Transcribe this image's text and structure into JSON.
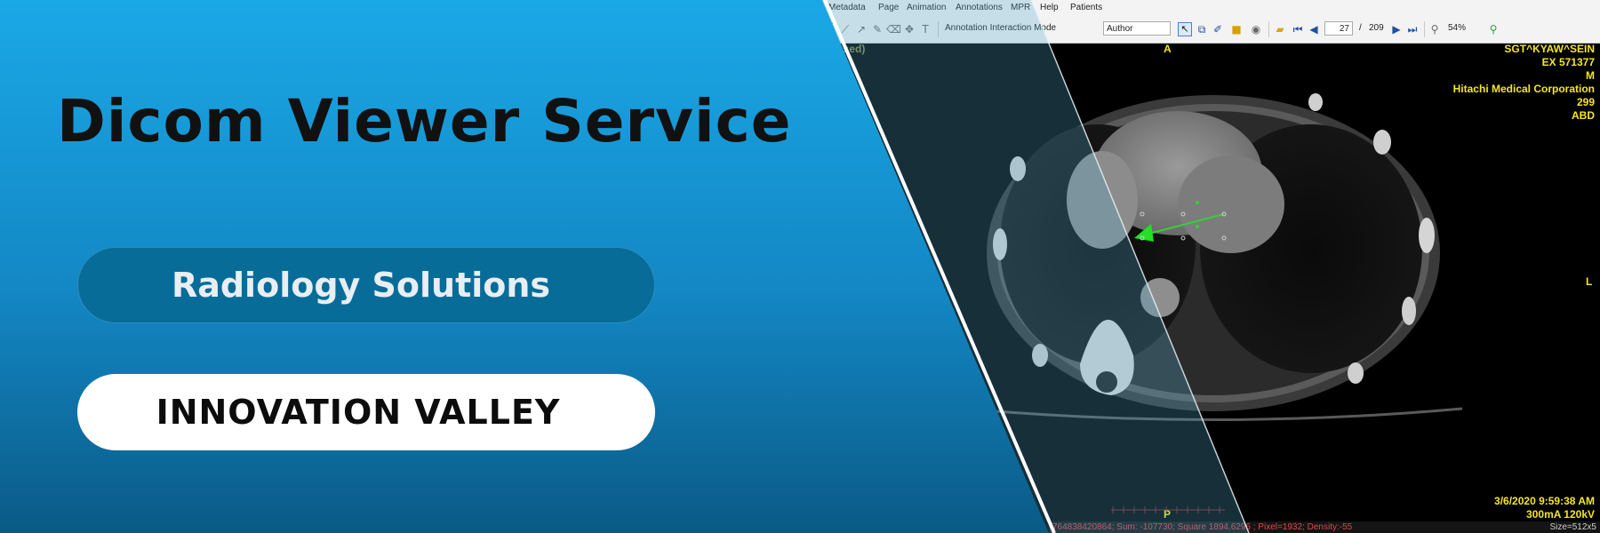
{
  "banner": {
    "headline": "Dicom Viewer Service",
    "tagline": "Radiology Solutions",
    "brand": "INNOVATION VALLEY",
    "colors": {
      "gradient_top": "#1aa8e6",
      "gradient_bottom": "#0a5a86",
      "pill_dark": "#086c99",
      "pill_light": "#ffffff",
      "headline": "#111111"
    }
  },
  "menu": {
    "items": [
      "Metadata",
      "Page",
      "Animation",
      "Annotations",
      "MPR",
      "Help",
      "Patients"
    ]
  },
  "toolbar": {
    "mode_label": "Annotation Interaction Mode",
    "mode_value": "Author",
    "page_current": "27",
    "page_separator": "/",
    "page_total": "209",
    "zoom": "54%",
    "icons": [
      "line-tool-icon",
      "polyline-tool-icon",
      "arrow-tool-icon",
      "pen-tool-icon",
      "eraser-icon",
      "move-icon",
      "text-tool-icon",
      "select-icon",
      "copy-icon",
      "highlight-icon",
      "color-icon",
      "visibility-icon",
      "folder-icon",
      "first-page-icon",
      "previous-page-icon",
      "next-page-icon",
      "last-page-icon",
      "zoom-out-icon",
      "zoom-in-icon"
    ]
  },
  "overlay": {
    "top_left_partial": "ssed)",
    "orientation_top": "A",
    "orientation_right": "L",
    "orientation_bottom": "P",
    "patient_name": "SGT^KYAW^SEIN",
    "exam": "EX 571377",
    "sex": "M",
    "manufacturer": "Hitachi Medical Corporation",
    "image_number": "299",
    "body_part": "ABD",
    "datetime": "3/6/2020 9:59:38 AM",
    "technique": "300mA 120kV",
    "overlay_color": "#f5e623"
  },
  "status": {
    "measurement": "764838420864; Sum: -107730; Square 1894.6296 ; Pixel=1932; Density:-55",
    "size": "Size=512x5"
  }
}
